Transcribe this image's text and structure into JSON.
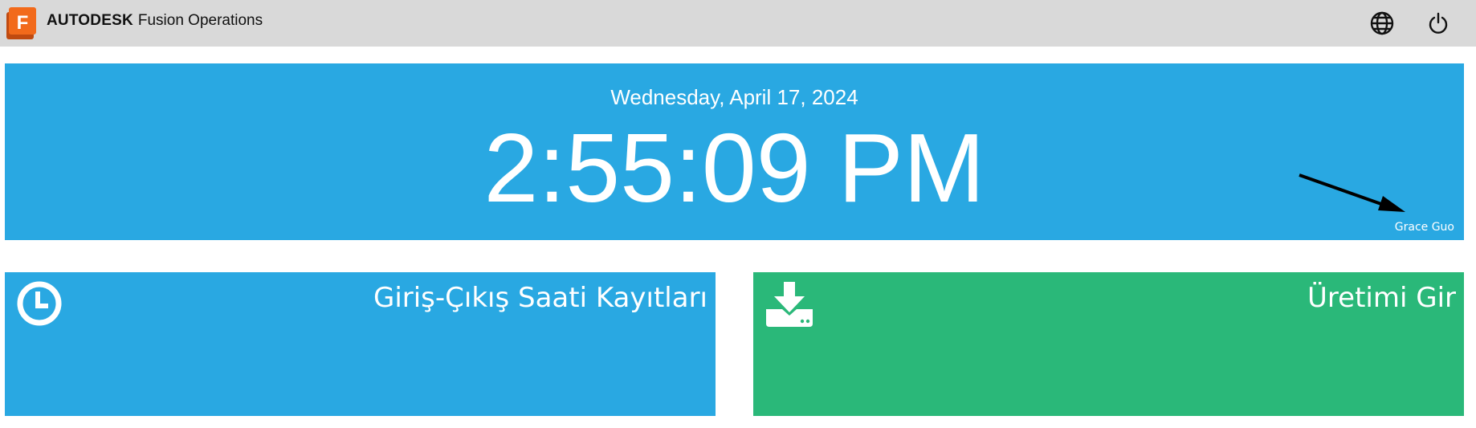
{
  "app": {
    "logo_letter": "F",
    "brand_primary": "AUTODESK",
    "brand_secondary": "Fusion Operations"
  },
  "header_icons": [
    "globe-icon",
    "power-icon"
  ],
  "clock": {
    "date": "Wednesday, April 17, 2024",
    "time": "2:55:09 PM",
    "user": "Grace Guo"
  },
  "tiles": [
    {
      "label": "Giriş-Çıkış Saati Kayıtları",
      "icon": "clock-icon",
      "color": "#29a8e2"
    },
    {
      "label": "Üretimi Gir",
      "icon": "download-icon",
      "color": "#2ab879"
    }
  ],
  "colors": {
    "header_bg": "#d9d9d9",
    "hero_bg": "#29a8e2",
    "logo_orange": "#f26a1b"
  }
}
